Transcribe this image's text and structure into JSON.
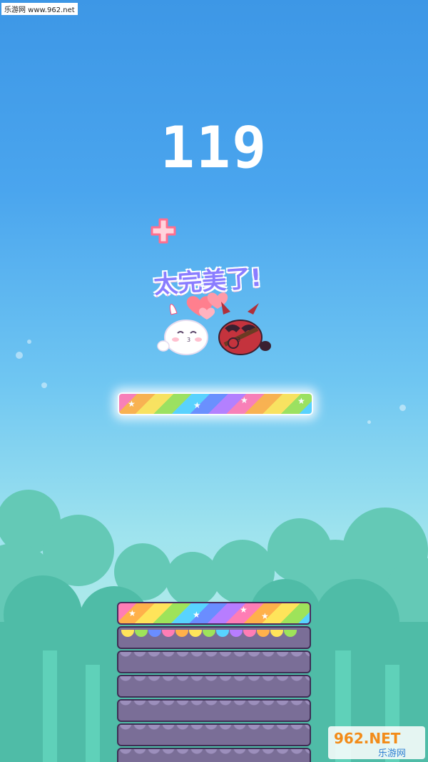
{
  "watermark_top": "乐游网 www.962.net",
  "score": "119",
  "perfect_text": "太完美了!",
  "watermark_bottom": {
    "brand": "962.NET",
    "sub": "乐游网"
  },
  "colors": {
    "rainbow": [
      "#ff7db5",
      "#ffb14a",
      "#ffe45a",
      "#9ee35a",
      "#58d3ff",
      "#6a8dff",
      "#b77dff"
    ],
    "tree": "#5cc5b2",
    "cake_layer": "#7a6e97"
  },
  "icons": [
    "plus-icon",
    "bunny-character",
    "ninja-character",
    "heart-icon"
  ],
  "tower_layers": 6
}
